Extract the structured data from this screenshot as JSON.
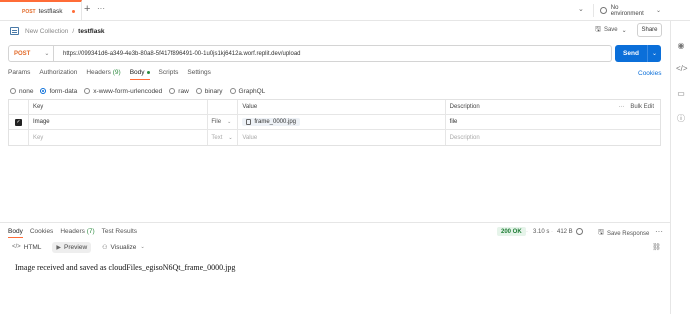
{
  "tab": {
    "method": "POST",
    "name": "testflask"
  },
  "environment": {
    "label": "No environment"
  },
  "breadcrumb": {
    "collection": "New Collection",
    "separator": "/",
    "request": "testflask"
  },
  "toolbar": {
    "save_label": "Save",
    "share_label": "Share"
  },
  "request": {
    "method": "POST",
    "url": "https://099341d6-a349-4e3b-80a8-5f417f896491-00-1u0js1kj6412a.worf.replit.dev/upload",
    "send_label": "Send"
  },
  "request_tabs": {
    "params": "Params",
    "authorization": "Authorization",
    "headers": "Headers",
    "headers_count": "(9)",
    "body": "Body",
    "scripts": "Scripts",
    "settings": "Settings",
    "cookies": "Cookies"
  },
  "body_types": [
    "none",
    "form-data",
    "x-www-form-urlencoded",
    "raw",
    "binary",
    "GraphQL"
  ],
  "body_type_selected": "form-data",
  "form_table": {
    "headers": {
      "key": "Key",
      "value": "Value",
      "description": "Description",
      "bulk_edit": "Bulk Edit"
    },
    "rows": [
      {
        "checked": true,
        "key": "Image",
        "type": "File",
        "value": "frame_0000.jpg",
        "description": "file"
      }
    ],
    "placeholder": {
      "key": "Key",
      "type": "Text",
      "value": "Value",
      "description": "Description"
    }
  },
  "response": {
    "tabs": {
      "body": "Body",
      "cookies": "Cookies",
      "headers": "Headers",
      "headers_count": "(7)",
      "test_results": "Test Results"
    },
    "status": "200 OK",
    "time": "3.10 s",
    "size": "412 B",
    "save_label": "Save Response",
    "views": {
      "html": "HTML",
      "preview": "Preview",
      "visualize": "Visualize"
    },
    "body_text": "Image received and saved as cloudFiles_egisoN6Qt_frame_0000.jpg"
  }
}
